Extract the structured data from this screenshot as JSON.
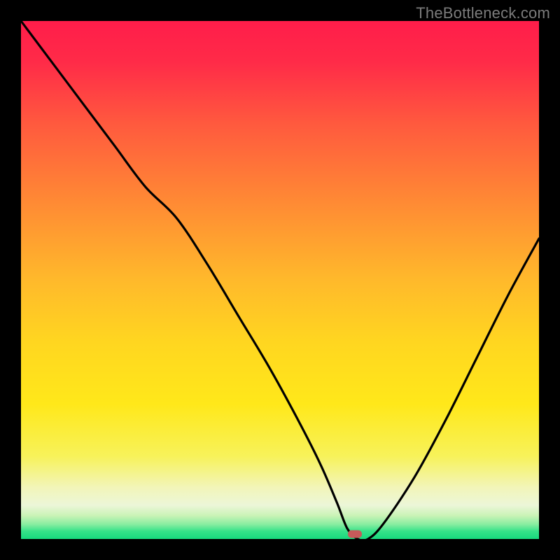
{
  "watermark": "TheBottleneck.com",
  "marker": {
    "x_pct": 64.5,
    "y_pct": 99.0,
    "color": "#c65a5a"
  },
  "gradient_stops": [
    {
      "offset": 0,
      "color": "#ff1d4a"
    },
    {
      "offset": 0.08,
      "color": "#ff2b48"
    },
    {
      "offset": 0.2,
      "color": "#ff5a3e"
    },
    {
      "offset": 0.35,
      "color": "#ff8a34"
    },
    {
      "offset": 0.5,
      "color": "#ffb92b"
    },
    {
      "offset": 0.62,
      "color": "#ffd620"
    },
    {
      "offset": 0.74,
      "color": "#ffe81a"
    },
    {
      "offset": 0.84,
      "color": "#f7f25a"
    },
    {
      "offset": 0.9,
      "color": "#f2f5b8"
    },
    {
      "offset": 0.935,
      "color": "#ecf6d8"
    },
    {
      "offset": 0.955,
      "color": "#c9f3b6"
    },
    {
      "offset": 0.972,
      "color": "#87eda0"
    },
    {
      "offset": 0.985,
      "color": "#36e289"
    },
    {
      "offset": 1.0,
      "color": "#17d97d"
    }
  ],
  "chart_data": {
    "type": "line",
    "title": "",
    "xlabel": "",
    "ylabel": "",
    "xlim": [
      0,
      100
    ],
    "ylim": [
      0,
      100
    ],
    "grid": false,
    "legend_position": "none",
    "series": [
      {
        "name": "bottleneck-curve",
        "x": [
          0,
          6,
          12,
          18,
          24,
          30,
          36,
          42,
          48,
          54,
          58,
          61,
          63,
          65,
          67,
          70,
          76,
          82,
          88,
          94,
          100
        ],
        "y": [
          100,
          92,
          84,
          76,
          68,
          62,
          53,
          43,
          33,
          22,
          14,
          7,
          2,
          0,
          0,
          3,
          12,
          23,
          35,
          47,
          58
        ]
      }
    ],
    "annotations": [
      {
        "type": "marker",
        "x": 64.5,
        "y": 1.0,
        "label": "optimal-point"
      }
    ],
    "background_gradient": "vertical red→orange→yellow→pale→green",
    "note": "y-axis inverted visually (0 at bottom, 100 at top); values above are classic y-up"
  }
}
